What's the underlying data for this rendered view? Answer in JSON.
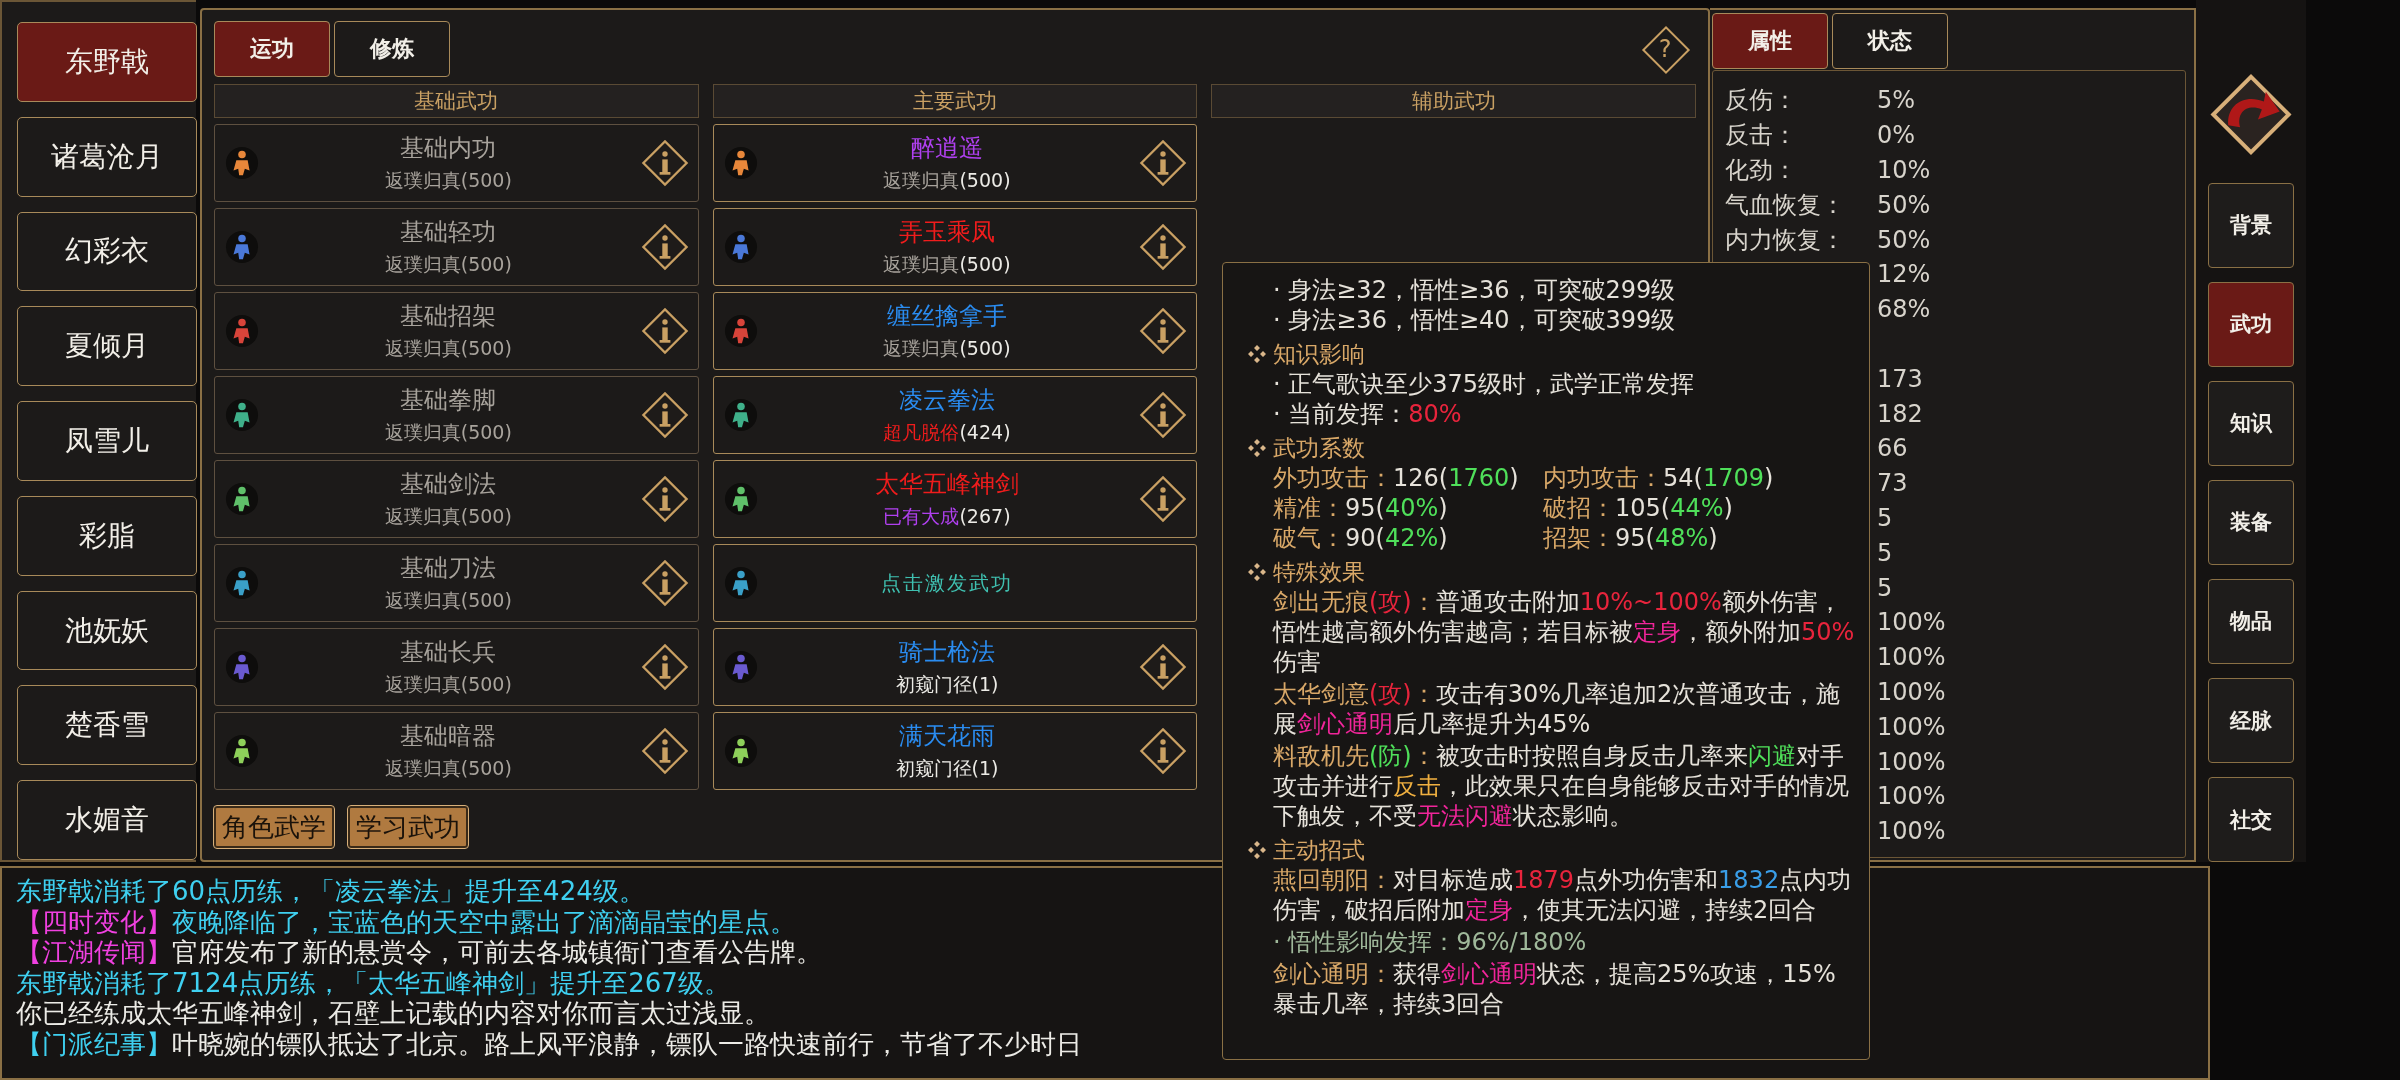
{
  "characters": [
    {
      "name": "东野戟",
      "selected": true
    },
    {
      "name": "诸葛沧月",
      "selected": false
    },
    {
      "name": "幻彩衣",
      "selected": false
    },
    {
      "name": "夏倾月",
      "selected": false
    },
    {
      "name": "凤雪儿",
      "selected": false
    },
    {
      "name": "彩脂",
      "selected": false
    },
    {
      "name": "池妩妖",
      "selected": false
    },
    {
      "name": "楚香雪",
      "selected": false
    },
    {
      "name": "水媚音",
      "selected": false
    }
  ],
  "tabs": [
    {
      "label": "运功",
      "selected": true
    },
    {
      "label": "修炼",
      "selected": false
    }
  ],
  "help_label": "?",
  "columns": [
    "基础武功",
    "主要武功",
    "辅助武功"
  ],
  "basic_skills": [
    {
      "name": "基础内功",
      "rank": "返璞归真",
      "level": "(500)",
      "color": "#e8873a"
    },
    {
      "name": "基础轻功",
      "rank": "返璞归真",
      "level": "(500)",
      "color": "#4a78d8"
    },
    {
      "name": "基础招架",
      "rank": "返璞归真",
      "level": "(500)",
      "color": "#d8443a"
    },
    {
      "name": "基础拳脚",
      "rank": "返璞归真",
      "level": "(500)",
      "color": "#3fb08a"
    },
    {
      "name": "基础剑法",
      "rank": "返璞归真",
      "level": "(500)",
      "color": "#5fc06a"
    },
    {
      "name": "基础刀法",
      "rank": "返璞归真",
      "level": "(500)",
      "color": "#3aa0c8"
    },
    {
      "name": "基础长兵",
      "rank": "返璞归真",
      "level": "(500)",
      "color": "#6a5ad0"
    },
    {
      "name": "基础暗器",
      "rank": "返璞归真",
      "level": "(500)",
      "color": "#8ed05a"
    }
  ],
  "main_skills": [
    {
      "kind": "skill",
      "name": {
        "text": "醉逍遥",
        "color": "#b040f0"
      },
      "rank": {
        "text": "返璞归真",
        "color": "#a8a39c"
      },
      "level": "(500)",
      "color": "#e8873a"
    },
    {
      "kind": "skill",
      "name": {
        "text": "弄玉乘凤",
        "color": "#f01c1c"
      },
      "rank": {
        "text": "返璞归真",
        "color": "#a8a39c"
      },
      "level": "(500)",
      "color": "#4a78d8"
    },
    {
      "kind": "skill",
      "name": {
        "text": "缠丝擒拿手",
        "color": "#2a8cf0"
      },
      "rank": {
        "text": "返璞归真",
        "color": "#a8a39c"
      },
      "level": "(500)",
      "color": "#d8443a"
    },
    {
      "kind": "skill",
      "name": {
        "text": "凌云拳法",
        "color": "#2a8cf0"
      },
      "rank": {
        "text": "超凡脱俗",
        "color": "#f01c1c"
      },
      "level": "(424)",
      "color": "#3fb08a"
    },
    {
      "kind": "skill",
      "name": {
        "text": "太华五峰神剑",
        "color": "#f01c1c"
      },
      "rank": {
        "text": "已有大成",
        "color": "#b040f0"
      },
      "level": "(267)",
      "color": "#5fc06a"
    },
    {
      "kind": "empty",
      "label": "点击激发武功",
      "color": "#3aa0c8"
    },
    {
      "kind": "skill",
      "name": {
        "text": "骑士枪法",
        "color": "#2a8cf0"
      },
      "rank": {
        "text": "初窥门径",
        "color": "#ecebe6"
      },
      "level": "(1)",
      "color": "#6a5ad0"
    },
    {
      "kind": "skill",
      "name": {
        "text": "满天花雨",
        "color": "#2a8cf0"
      },
      "rank": {
        "text": "初窥门径",
        "color": "#ecebe6"
      },
      "level": "(1)",
      "color": "#8ed05a"
    }
  ],
  "bottom_buttons": [
    "角色武学",
    "学习武功"
  ],
  "attribute_tabs": [
    {
      "label": "属性",
      "selected": true
    },
    {
      "label": "状态",
      "selected": false
    }
  ],
  "attributes": [
    {
      "label": "反伤：",
      "value": "5%"
    },
    {
      "label": "反击：",
      "value": "0%"
    },
    {
      "label": "化劲：",
      "value": "10%"
    },
    {
      "label": "气血恢复：",
      "value": "50%"
    },
    {
      "label": "内力恢复：",
      "value": "50%"
    },
    {
      "value": "12%"
    },
    {
      "value": "68%"
    },
    {
      "value": "173",
      "gap_before": true
    },
    {
      "value": "182"
    },
    {
      "value": "66"
    },
    {
      "value": "73"
    },
    {
      "value": "5"
    },
    {
      "value": "5"
    },
    {
      "value": "5"
    },
    {
      "value": "100%"
    },
    {
      "value": "100%"
    },
    {
      "value": "100%"
    },
    {
      "value": "100%"
    },
    {
      "value": "100%"
    },
    {
      "value": "100%"
    },
    {
      "value": "100%"
    }
  ],
  "nav": [
    {
      "label": "背景",
      "selected": false
    },
    {
      "label": "武功",
      "selected": true
    },
    {
      "label": "知识",
      "selected": false
    },
    {
      "label": "装备",
      "selected": false
    },
    {
      "label": "物品",
      "selected": false
    },
    {
      "label": "经脉",
      "selected": false
    },
    {
      "label": "社交",
      "selected": false
    }
  ],
  "log": [
    [
      {
        "text": "东野戟消耗了60点历练，「凌云拳法」提升至424级。",
        "color": "#3fd0f0"
      }
    ],
    [
      {
        "text": "【四时变化】",
        "color": "#f040e0"
      },
      {
        "text": "夜晚降临了，宝蓝色的天空中露出了滴滴晶莹的星点。",
        "color": "#3fd0f0"
      }
    ],
    [
      {
        "text": "【江湖传闻】",
        "color": "#f040e0"
      },
      {
        "text": "官府发布了新的悬赏令，可前去各城镇衙门查看公告牌。",
        "color": "#ecebe6"
      }
    ],
    [
      {
        "text": "东野戟消耗了7124点历练，「太华五峰神剑」提升至267级。",
        "color": "#3fd0f0"
      }
    ],
    [
      {
        "text": "你已经练成太华五峰神剑，石壁上记载的内容对你而言太过浅显。",
        "color": "#ecebe6"
      }
    ],
    [
      {
        "text": "【门派纪事】",
        "color": "#3fd0f0"
      },
      {
        "text": "叶晓婉的镖队抵达了北京。路上风平浪静，镖队一路快速前行，节省了不少时日",
        "color": "#ecebe6"
      }
    ]
  ],
  "tooltip": {
    "sections": [
      {
        "bullets": [
          [
            {
              "text": "· 身法≥32，悟性≥36，可突破299级",
              "color": "#e6e2da"
            }
          ],
          [
            {
              "text": "· 身法≥36，悟性≥40，可突破399级",
              "color": "#e6e2da"
            }
          ]
        ]
      },
      {
        "heading": "知识影响",
        "bullets": [
          [
            {
              "text": "· 正气歌诀至少375级时，武学正常发挥",
              "color": "#e6e2da"
            }
          ],
          [
            {
              "text": "· 当前发挥：",
              "color": "#e6e2da"
            },
            {
              "text": "80%",
              "color": "#e8243c"
            }
          ]
        ]
      },
      {
        "heading": "武功系数",
        "stats": [
          [
            {
              "text": "外功攻击：",
              "color": "#d9a868"
            },
            {
              "text": "126(",
              "color": "#e6e2da"
            },
            {
              "text": "1760",
              "color": "#4fe05a"
            },
            {
              "text": ")",
              "color": "#e6e2da"
            }
          ],
          [
            {
              "text": "内功攻击：",
              "color": "#d9a868"
            },
            {
              "text": "54(",
              "color": "#e6e2da"
            },
            {
              "text": "1709",
              "color": "#4fe05a"
            },
            {
              "text": ")",
              "color": "#e6e2da"
            }
          ],
          [
            {
              "text": "精准：",
              "color": "#d9a868"
            },
            {
              "text": "95(",
              "color": "#e6e2da"
            },
            {
              "text": "40%",
              "color": "#4fe05a"
            },
            {
              "text": ")",
              "color": "#e6e2da"
            }
          ],
          [
            {
              "text": "破招：",
              "color": "#d9a868"
            },
            {
              "text": "105(",
              "color": "#e6e2da"
            },
            {
              "text": "44%",
              "color": "#4fe05a"
            },
            {
              "text": ")",
              "color": "#e6e2da"
            }
          ],
          [
            {
              "text": "破气：",
              "color": "#d9a868"
            },
            {
              "text": "90(",
              "color": "#e6e2da"
            },
            {
              "text": "42%",
              "color": "#4fe05a"
            },
            {
              "text": ")",
              "color": "#e6e2da"
            }
          ],
          [
            {
              "text": "招架：",
              "color": "#d9a868"
            },
            {
              "text": "95(",
              "color": "#e6e2da"
            },
            {
              "text": "48%",
              "color": "#4fe05a"
            },
            {
              "text": ")",
              "color": "#e6e2da"
            }
          ]
        ]
      },
      {
        "heading": "特殊效果",
        "paragraphs": [
          [
            {
              "text": "剑出无痕",
              "color": "#d9a868"
            },
            {
              "text": "(攻)",
              "color": "#e8243c"
            },
            {
              "text": "：",
              "color": "#d9a868"
            },
            {
              "text": "普通攻击附加",
              "color": "#e6e2da"
            },
            {
              "text": "10%~100%",
              "color": "#e8243c"
            },
            {
              "text": "额外伤害，悟性越高额外伤害越高；若目标被",
              "color": "#e6e2da"
            },
            {
              "text": "定身",
              "color": "#f0259a"
            },
            {
              "text": "，额外附加",
              "color": "#e6e2da"
            },
            {
              "text": "50%",
              "color": "#e8243c"
            },
            {
              "text": "伤害",
              "color": "#e6e2da"
            }
          ],
          [
            {
              "text": "太华剑意",
              "color": "#d9a868"
            },
            {
              "text": "(攻)",
              "color": "#e8243c"
            },
            {
              "text": "：",
              "color": "#d9a868"
            },
            {
              "text": "攻击有30%几率追加2次普通攻击，施展",
              "color": "#e6e2da"
            },
            {
              "text": "剑心通明",
              "color": "#f0259a"
            },
            {
              "text": "后几率提升为45%",
              "color": "#e6e2da"
            }
          ],
          [
            {
              "text": "料敌机先",
              "color": "#d9a868"
            },
            {
              "text": "(防)",
              "color": "#4fe05a"
            },
            {
              "text": "：",
              "color": "#d9a868"
            },
            {
              "text": "被攻击时按照自身反击几率来",
              "color": "#e6e2da"
            },
            {
              "text": "闪避",
              "color": "#4fe05a"
            },
            {
              "text": "对手攻击并进行",
              "color": "#e6e2da"
            },
            {
              "text": "反击",
              "color": "#f0b040"
            },
            {
              "text": "，此效果只在自身能够反击对手的情况下触发，不受",
              "color": "#e6e2da"
            },
            {
              "text": "无法闪避",
              "color": "#f0259a"
            },
            {
              "text": "状态影响。",
              "color": "#e6e2da"
            }
          ]
        ]
      },
      {
        "heading": "主动招式",
        "paragraphs": [
          [
            {
              "text": "燕回朝阳：",
              "color": "#d9a868"
            },
            {
              "text": "对目标造成",
              "color": "#e6e2da"
            },
            {
              "text": "1879",
              "color": "#e8243c"
            },
            {
              "text": "点外功伤害和",
              "color": "#e6e2da"
            },
            {
              "text": "1832",
              "color": "#3a9ee8"
            },
            {
              "text": "点内功伤害，破招后附加",
              "color": "#e6e2da"
            },
            {
              "text": "定身",
              "color": "#f0259a"
            },
            {
              "text": "，使其无法闪避，持续2回合",
              "color": "#e6e2da"
            }
          ],
          [
            {
              "text": "· 悟性影响发挥：96%/180%",
              "color": "#9fb89a"
            }
          ],
          [
            {
              "text": "剑心通明：",
              "color": "#d9a868"
            },
            {
              "text": "获得",
              "color": "#e6e2da"
            },
            {
              "text": "剑心通明",
              "color": "#f0259a"
            },
            {
              "text": "状态，提高25%攻速，15%暴击几率，持续3回合",
              "color": "#e6e2da"
            }
          ]
        ]
      }
    ]
  }
}
